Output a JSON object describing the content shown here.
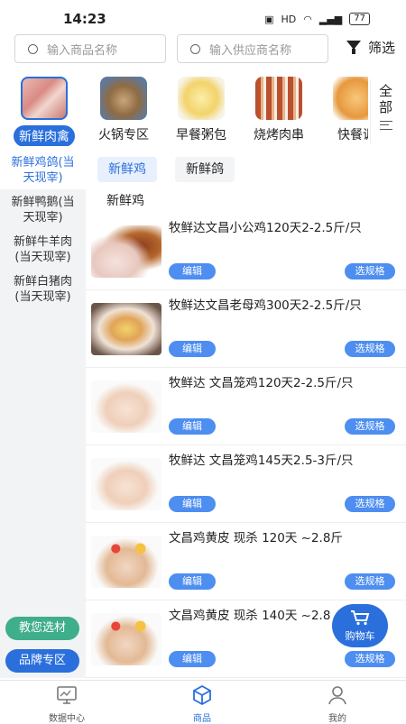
{
  "status_bar": {
    "time": "14:23",
    "battery": "77"
  },
  "search": {
    "product_placeholder": "输入商品名称",
    "supplier_placeholder": "输入供应商名称",
    "filter_label": "筛选"
  },
  "categories": [
    {
      "label": "新鲜肉禽",
      "active": true
    },
    {
      "label": "火锅专区",
      "active": false
    },
    {
      "label": "早餐粥包",
      "active": false
    },
    {
      "label": "烧烤肉串",
      "active": false
    },
    {
      "label": "快餐调",
      "active": false
    }
  ],
  "all_button": {
    "label_line1": "全",
    "label_line2": "部"
  },
  "side_nav": {
    "items": [
      {
        "label_line1": "新鲜鸡鸽(当",
        "label_line2": "天现宰)",
        "active": true
      },
      {
        "label_line1": "新鲜鸭鹅(当",
        "label_line2": "天现宰)",
        "active": false
      },
      {
        "label_line1": "新鲜牛羊肉",
        "label_line2": "(当天现宰)",
        "active": false
      },
      {
        "label_line1": "新鲜白猪肉",
        "label_line2": "(当天现宰)",
        "active": false
      }
    ],
    "teach_button": "教您选材",
    "brand_button": "品牌专区"
  },
  "sub_tabs": [
    {
      "label": "新鲜鸡",
      "active": true
    },
    {
      "label": "新鲜鸽",
      "active": false
    }
  ],
  "sub_section_title": "新鲜鸡",
  "products": [
    {
      "name": "牧鲜达文昌小公鸡120天2-2.5斤/只",
      "edit": "编辑",
      "spec": "选规格"
    },
    {
      "name": "牧鲜达文昌老母鸡300天2-2.5斤/只",
      "edit": "编辑",
      "spec": "选规格"
    },
    {
      "name": "牧鲜达 文昌笼鸡120天2-2.5斤/只",
      "edit": "编辑",
      "spec": "选规格"
    },
    {
      "name": "牧鲜达 文昌笼鸡145天2.5-3斤/只",
      "edit": "编辑",
      "spec": "选规格"
    },
    {
      "name": "文昌鸡黄皮 现杀 120天 ~2.8斤",
      "edit": "编辑",
      "spec": "选规格"
    },
    {
      "name": "文昌鸡黄皮 现杀 140天 ~2.8",
      "edit": "编辑",
      "spec": "选规格"
    }
  ],
  "cart": {
    "label": "购物车"
  },
  "bottom_nav": [
    {
      "label": "数据中心",
      "icon": "monitor-icon",
      "active": false
    },
    {
      "label": "商品",
      "icon": "box-icon",
      "active": true
    },
    {
      "label": "我的",
      "icon": "user-icon",
      "active": false
    }
  ],
  "colors": {
    "accent": "#2a6fdc",
    "button": "#4d8ef0",
    "teach_button": "#3fae8a",
    "brand_button": "#2a6fdc"
  }
}
